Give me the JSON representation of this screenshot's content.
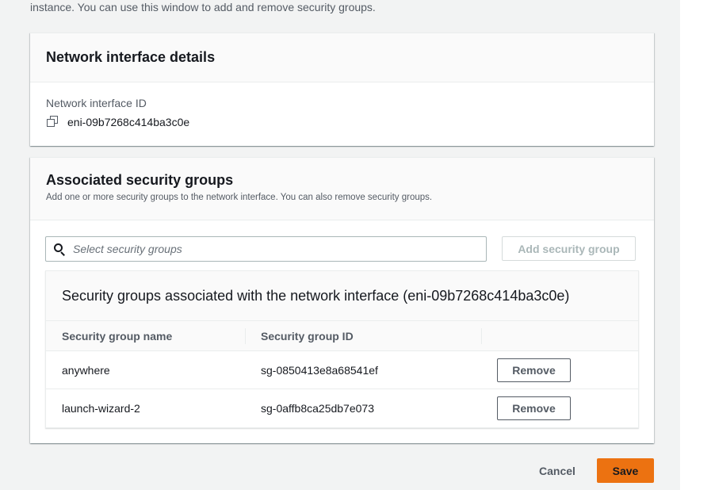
{
  "intro_text": "instance. You can use this window to add and remove security groups.",
  "network_interface_details": {
    "title": "Network interface details",
    "id_label": "Network interface ID",
    "id_value": "eni-09b7268c414ba3c0e"
  },
  "associated_security_groups": {
    "title": "Associated security groups",
    "description": "Add one or more security groups to the network interface. You can also remove security groups.",
    "search_placeholder": "Select security groups",
    "add_button_label": "Add security group",
    "table": {
      "title": "Security groups associated with the network interface (eni-09b7268c414ba3c0e)",
      "columns": [
        "Security group name",
        "Security group ID",
        ""
      ],
      "rows": [
        {
          "name": "anywhere",
          "id": "sg-0850413e8a68541ef",
          "action": "Remove"
        },
        {
          "name": "launch-wizard-2",
          "id": "sg-0affb8ca25db7e073",
          "action": "Remove"
        }
      ]
    }
  },
  "footer": {
    "cancel_label": "Cancel",
    "save_label": "Save"
  },
  "colors": {
    "primary_button": "#ec7211",
    "page_background": "#f2f3f3",
    "text": "#16191f",
    "secondary_text": "#545b64"
  },
  "icons": {
    "copy": "copy-icon",
    "search": "search-icon"
  }
}
